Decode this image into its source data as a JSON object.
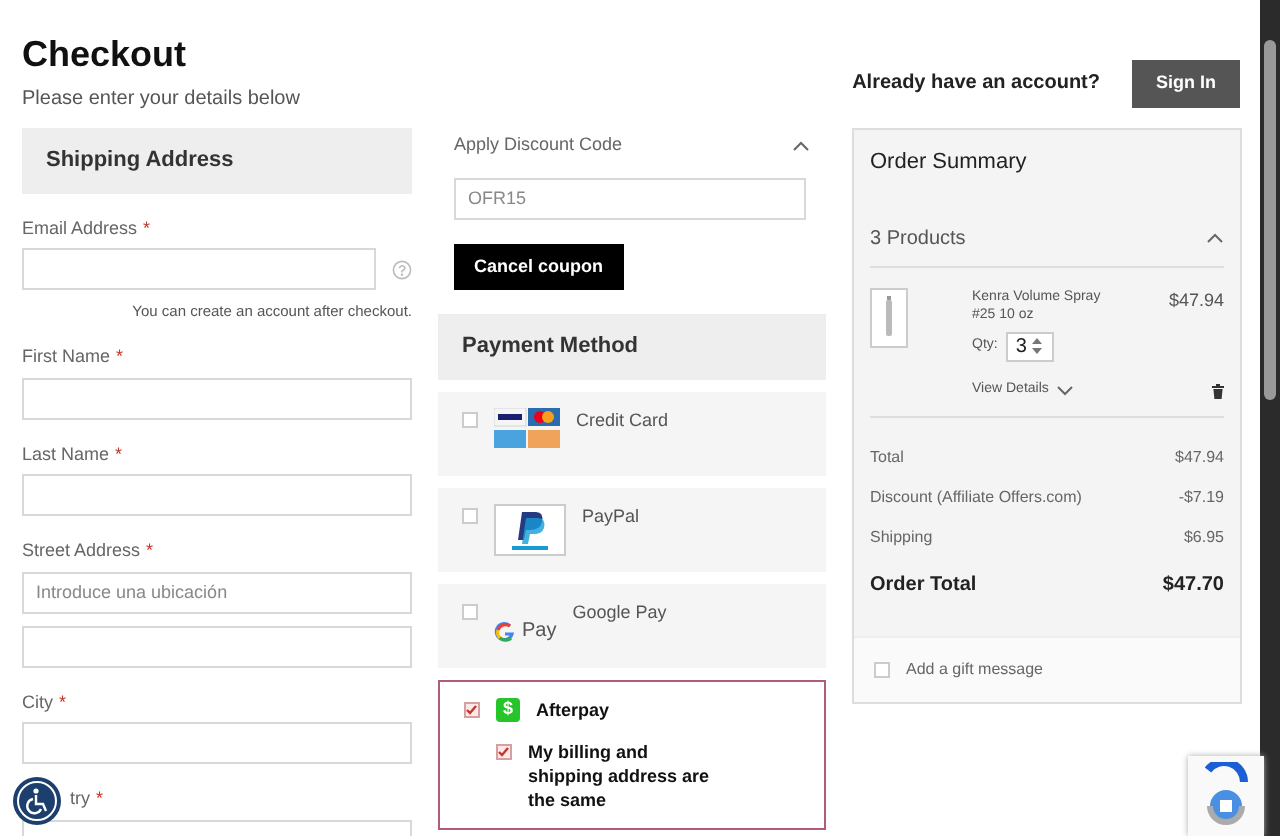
{
  "header": {
    "title": "Checkout",
    "subtitle": "Please enter your details below",
    "account_prompt": "Already have an account?",
    "sign_in": "Sign In"
  },
  "shipping": {
    "heading": "Shipping Address",
    "fields": [
      {
        "label": "Email Address",
        "mark": "*",
        "help": true,
        "hint": "You can create an account after checkout."
      },
      {
        "label": "First Name",
        "mark": "*"
      },
      {
        "label": "Last Name",
        "mark": "*"
      },
      {
        "label": "Street Address",
        "mark": "*",
        "placeholder": "Introduce una ubicación"
      },
      {
        "kind": "plain"
      },
      {
        "label": "City",
        "mark": "*"
      },
      {
        "label": "try",
        "mark": "*"
      }
    ]
  },
  "discount": {
    "title": "Apply Discount Code",
    "expanded": true,
    "placeholder": "OFR15",
    "button": "Cancel coupon"
  },
  "payment": {
    "heading": "Payment Method",
    "methods": [
      {
        "kind": "card",
        "label": "Credit Card",
        "selected": false
      },
      {
        "kind": "paypal",
        "label": "PayPal",
        "selected": false
      },
      {
        "kind": "gpay",
        "label": "Google Pay",
        "logo_text": "Pay",
        "selected": false
      },
      {
        "kind": "afterpay",
        "label": "Afterpay",
        "logo_text": "$",
        "selected": true,
        "option": {
          "label": "My billing and shipping address are the same",
          "checked": true
        }
      }
    ]
  },
  "summary": {
    "title": "Order Summary",
    "products_label": "3 Products",
    "expanded": true,
    "items": [
      {
        "name": "Kenra Volume Spray #25 10 oz",
        "price": "$47.94",
        "qty_label": "Qty:",
        "qty": "3",
        "details": "View Details"
      }
    ],
    "totals": [
      {
        "label": "Total",
        "value": "$47.94"
      },
      {
        "label": "Discount (Affiliate Offers.com)",
        "value": "-$7.19"
      },
      {
        "label": "Shipping",
        "value": "$6.95"
      }
    ],
    "order_total": {
      "label": "Order Total",
      "value": "$47.70"
    },
    "gift": {
      "label": "Add a gift message",
      "checked": false
    }
  }
}
